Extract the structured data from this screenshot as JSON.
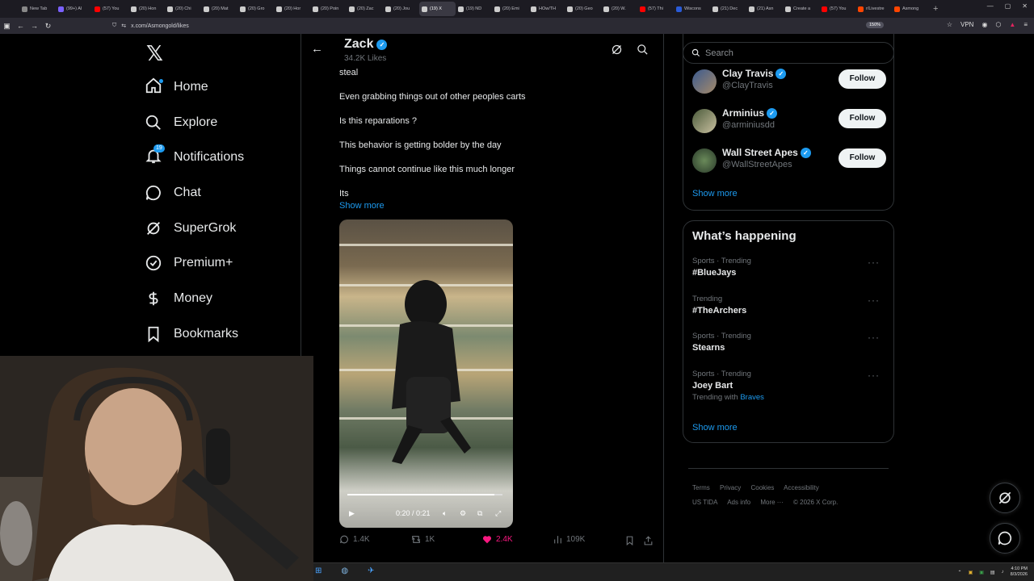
{
  "browser": {
    "tabs": [
      {
        "label": "New Tab",
        "color": "#888888"
      },
      {
        "label": "(99+) Al",
        "color": "#7b61ff"
      },
      {
        "label": "(57) You",
        "color": "#ff0000"
      },
      {
        "label": "(20) Hon",
        "color": "#cccccc"
      },
      {
        "label": "(20) Chi",
        "color": "#cccccc"
      },
      {
        "label": "(20) Mat",
        "color": "#cccccc"
      },
      {
        "label": "(20) Gro",
        "color": "#cccccc"
      },
      {
        "label": "(20) Hor",
        "color": "#cccccc"
      },
      {
        "label": "(20) Poin",
        "color": "#cccccc"
      },
      {
        "label": "(20) Zac",
        "color": "#cccccc"
      },
      {
        "label": "(20) Jou",
        "color": "#cccccc"
      },
      {
        "label": "(19) X",
        "color": "#cccccc",
        "active": true
      },
      {
        "label": "(19) ND",
        "color": "#cccccc"
      },
      {
        "label": "(20) Emi",
        "color": "#cccccc"
      },
      {
        "label": "HOw/TH",
        "color": "#cccccc"
      },
      {
        "label": "(20) Geo",
        "color": "#cccccc"
      },
      {
        "label": "(20) W.",
        "color": "#cccccc"
      },
      {
        "label": "(57) Thi",
        "color": "#ff0000"
      },
      {
        "label": "Wiscons",
        "color": "#2a5bd7"
      },
      {
        "label": "(21) Dec",
        "color": "#cccccc"
      },
      {
        "label": "(21) Asn",
        "color": "#cccccc"
      },
      {
        "label": "Create a",
        "color": "#cccccc"
      },
      {
        "label": "(57) You",
        "color": "#ff0000"
      },
      {
        "label": "r/Livestre",
        "color": "#ff4500"
      },
      {
        "label": "Asmong",
        "color": "#ff4500"
      }
    ],
    "url": "x.com/Asmongold/likes",
    "zoom": "150%",
    "vpn_label": "VPN"
  },
  "leftnav": {
    "items": [
      {
        "label": "Home",
        "icon": "home-icon"
      },
      {
        "label": "Explore",
        "icon": "search-icon"
      },
      {
        "label": "Notifications",
        "icon": "bell-icon",
        "badge": "19"
      },
      {
        "label": "Chat",
        "icon": "chat-icon"
      },
      {
        "label": "SuperGrok",
        "icon": "grok-icon"
      },
      {
        "label": "Premium+",
        "icon": "premium-icon"
      },
      {
        "label": "Money",
        "icon": "money-icon"
      },
      {
        "label": "Bookmarks",
        "icon": "bookmark-icon"
      }
    ]
  },
  "header": {
    "name": "Zack",
    "likes": "34.2K Likes"
  },
  "post": {
    "lines": [
      "steal",
      "Even grabbing things out of other peoples carts",
      "Is this reparations ?",
      "This behavior is getting bolder by the day",
      "Things cannot continue like this much longer",
      "Its"
    ],
    "show_more": "Show more",
    "video_time": "0:20 / 0:21",
    "video_progress": 0.95,
    "replies": "1.4K",
    "reposts": "1K",
    "likes": "2.4K",
    "views": "109K",
    "like_color": "#f91880"
  },
  "right": {
    "search_placeholder": "Search",
    "follow_suggestions": [
      {
        "name": "Clay Travis",
        "handle": "@ClayTravis",
        "button": "Follow"
      },
      {
        "name": "Arminius",
        "handle": "@arminiusdd",
        "button": "Follow"
      },
      {
        "name": "Wall Street Apes",
        "handle": "@WallStreetApes",
        "button": "Follow"
      }
    ],
    "follow_show_more": "Show more",
    "happening_title": "What’s happening",
    "trends": [
      {
        "category": "Sports · Trending",
        "name": "#BlueJays"
      },
      {
        "category": "Trending",
        "name": "#TheArchers"
      },
      {
        "category": "Sports · Trending",
        "name": "Stearns"
      },
      {
        "category": "Sports · Trending",
        "name": "Joey Bart",
        "with_label": "Trending with",
        "with_value": "Braves"
      }
    ],
    "trends_show_more": "Show more",
    "footer": {
      "links": [
        "Terms",
        "Privacy",
        "Cookies",
        "Accessibility",
        "US TIDA",
        "Ads info",
        "More ···",
        "© 2026 X Corp."
      ]
    }
  },
  "taskbar": {
    "time": "4:10 PM",
    "date": "8/3/2026"
  },
  "colors": {
    "accent": "#1d9bf0",
    "background": "#000000",
    "border": "#2f3336"
  }
}
